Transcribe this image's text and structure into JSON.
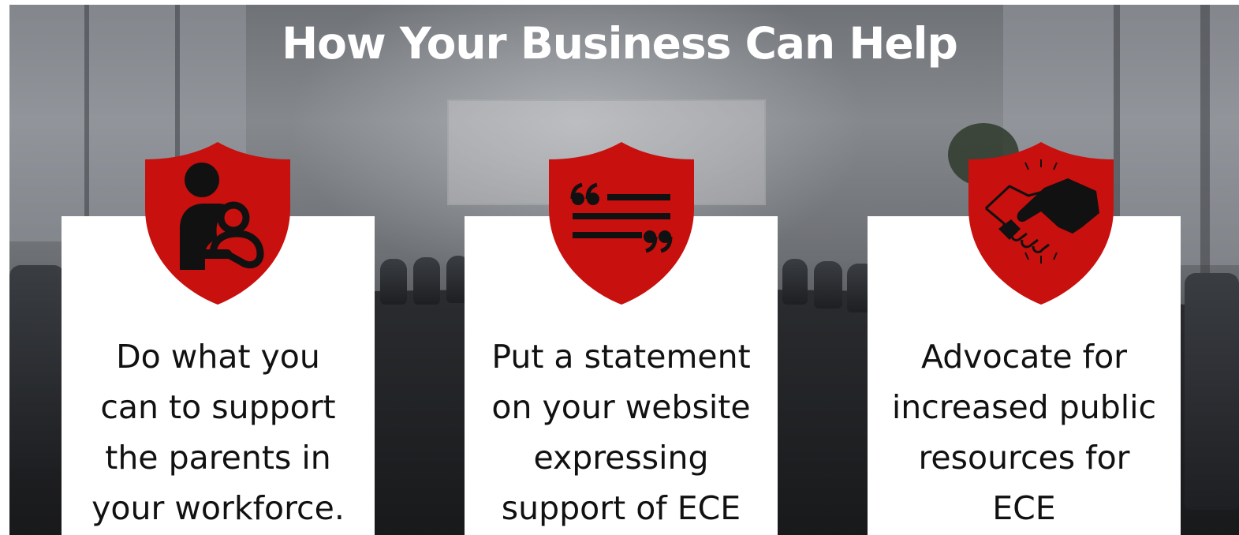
{
  "title": "How Your Business Can Help",
  "colors": {
    "shield": "#c8100e",
    "icon": "#111111",
    "card": "#ffffff",
    "title": "#ffffff"
  },
  "cards": [
    {
      "icon": "parent-with-child-icon",
      "lines": [
        "Do what you",
        "can to support",
        "the parents in",
        "your workforce."
      ]
    },
    {
      "icon": "quote-statement-icon",
      "lines": [
        "Put a statement",
        "on your website",
        "expressing",
        "support of ECE"
      ]
    },
    {
      "icon": "handshake-icon",
      "lines": [
        "Advocate for",
        "increased public",
        "resources for",
        "ECE"
      ]
    }
  ]
}
